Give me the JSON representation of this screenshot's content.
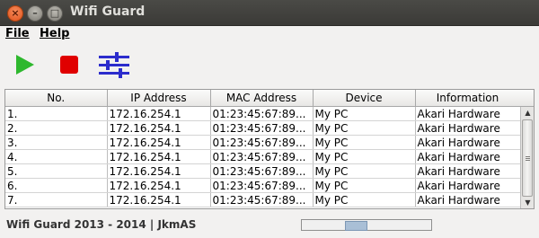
{
  "window": {
    "title": "Wifi Guard",
    "close_glyph": "×",
    "min_glyph": "–",
    "max_glyph": "□"
  },
  "menu": {
    "file": "File",
    "help": "Help"
  },
  "toolbar": {
    "start_icon": "play-icon",
    "stop_icon": "stop-icon",
    "settings_icon": "sliders-icon",
    "start_color": "#2eb82e",
    "stop_color": "#e00000",
    "settings_color": "#2c2ccc"
  },
  "table": {
    "columns": [
      "No.",
      "IP Address",
      "MAC Address",
      "Device",
      "Information"
    ],
    "rows": [
      [
        "1.",
        "172.16.254.1",
        "01:23:45:67:89...",
        "My PC",
        "Akari Hardware"
      ],
      [
        "2.",
        "172.16.254.1",
        "01:23:45:67:89...",
        "My PC",
        "Akari Hardware"
      ],
      [
        "3.",
        "172.16.254.1",
        "01:23:45:67:89...",
        "My PC",
        "Akari Hardware"
      ],
      [
        "4.",
        "172.16.254.1",
        "01:23:45:67:89...",
        "My PC",
        "Akari Hardware"
      ],
      [
        "5.",
        "172.16.254.1",
        "01:23:45:67:89...",
        "My PC",
        "Akari Hardware"
      ],
      [
        "6.",
        "172.16.254.1",
        "01:23:45:67:89...",
        "My PC",
        "Akari Hardware"
      ],
      [
        "7.",
        "172.16.254.1",
        "01:23:45:67:89...",
        "My PC",
        "Akari Hardware"
      ]
    ]
  },
  "scrollbar": {
    "up_glyph": "▲",
    "down_glyph": "▼"
  },
  "status": {
    "text": "Wifi Guard 2013 - 2014 | JkmAS",
    "progress_start": 0.33,
    "progress_width": 0.16
  }
}
